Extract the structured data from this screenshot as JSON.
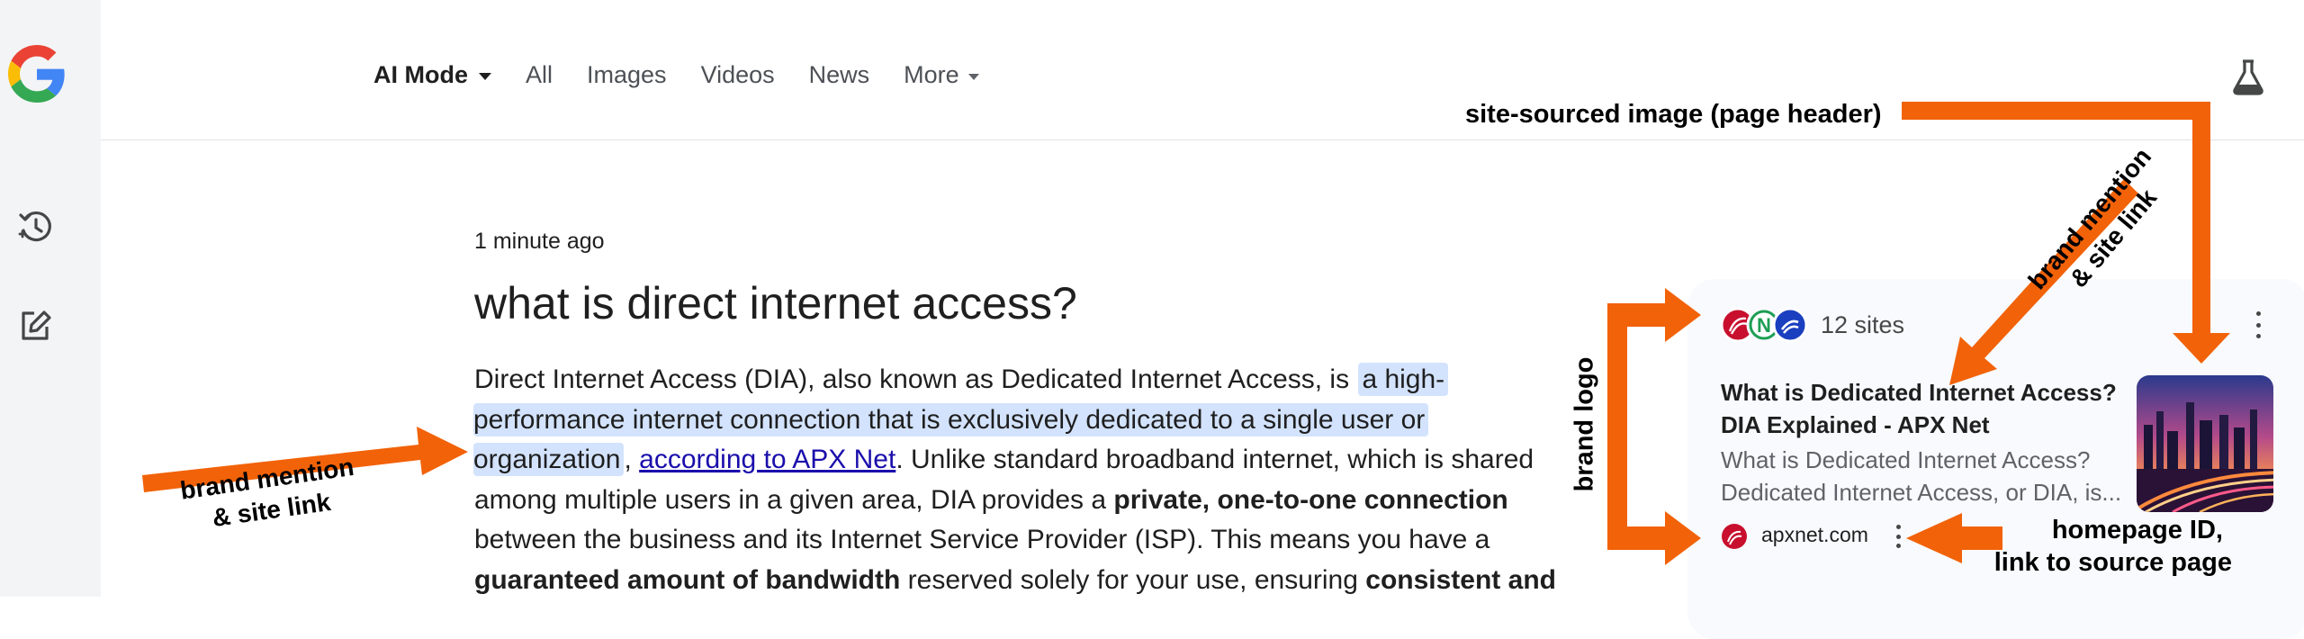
{
  "nav": {
    "ai_mode": "AI Mode",
    "all": "All",
    "images": "Images",
    "videos": "Videos",
    "news": "News",
    "more": "More"
  },
  "answer": {
    "timestamp": "1 minute ago",
    "query": "what is direct internet access?",
    "line1_text": "Direct Internet Access (DIA), also known as Dedicated Internet Access, is",
    "line1_hl": "a high-",
    "line2_hl": "performance internet connection that is exclusively dedicated to a single user or",
    "line3_hl": "organization",
    "line3_comma": ",",
    "line3_link": "according to APX Net",
    "line3_rest": ". Unlike standard broadband internet, which is shared",
    "line4_a": "among multiple users in a given area, DIA provides a",
    "line4_b": "private, one-to-one connection",
    "line5": "between the business and its Internet Service Provider (ISP). This means you have a",
    "line6_a": "guaranteed amount of bandwidth",
    "line6_b": "reserved solely for your use, ensuring",
    "line6_c": "consistent and"
  },
  "sources_panel": {
    "sites_count": "12 sites",
    "card_title_line1": "What is Dedicated Internet Access?",
    "card_title_line2": "DIA Explained - APX Net",
    "card_snippet_line1": "What is Dedicated Internet Access?",
    "card_snippet_line2": "Dedicated Internet Access, or DIA, is...",
    "domain": "apxnet.com"
  },
  "annotations": {
    "site_image": "site-sourced image (page header)",
    "brand_mention_right_1": "brand mention",
    "brand_mention_right_2": "& site link",
    "brand_mention_left_1": "brand mention",
    "brand_mention_left_2": "& site link",
    "brand_logo": "brand logo",
    "homepage_1": "homepage ID,",
    "homepage_2": "link to source page"
  },
  "colors": {
    "arrow": "#f26208",
    "highlight": "#d3e3fd",
    "link": "#1a0dab",
    "panel_bg": "#f8fafd",
    "rail_bg": "#f3f4f6"
  },
  "icons": [
    "google-logo",
    "history-icon",
    "new-chat-icon",
    "labs-flask-icon",
    "more-options-icon"
  ]
}
